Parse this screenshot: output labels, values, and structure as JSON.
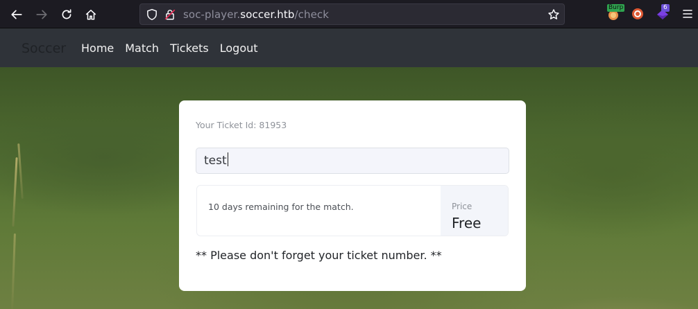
{
  "browser": {
    "url_prefix": "soc-player.",
    "url_host": "soccer.htb",
    "url_path": "/check",
    "extensions": {
      "burp_badge": "Burp",
      "counter_badge": "6"
    }
  },
  "site": {
    "brand": "Soccer",
    "nav": [
      "Home",
      "Match",
      "Tickets",
      "Logout"
    ]
  },
  "ticket": {
    "id_label": "Your Ticket Id: 81953",
    "input_value": "test",
    "info_text": "10 days remaining for the match.",
    "price_label": "Price",
    "price_value": "Free",
    "reminder": "** Please don't forget your ticket number. **"
  },
  "colors": {
    "browser_bg": "#1c1b22",
    "navbar_bg": "#2f3339",
    "card_bg": "#ffffff"
  }
}
